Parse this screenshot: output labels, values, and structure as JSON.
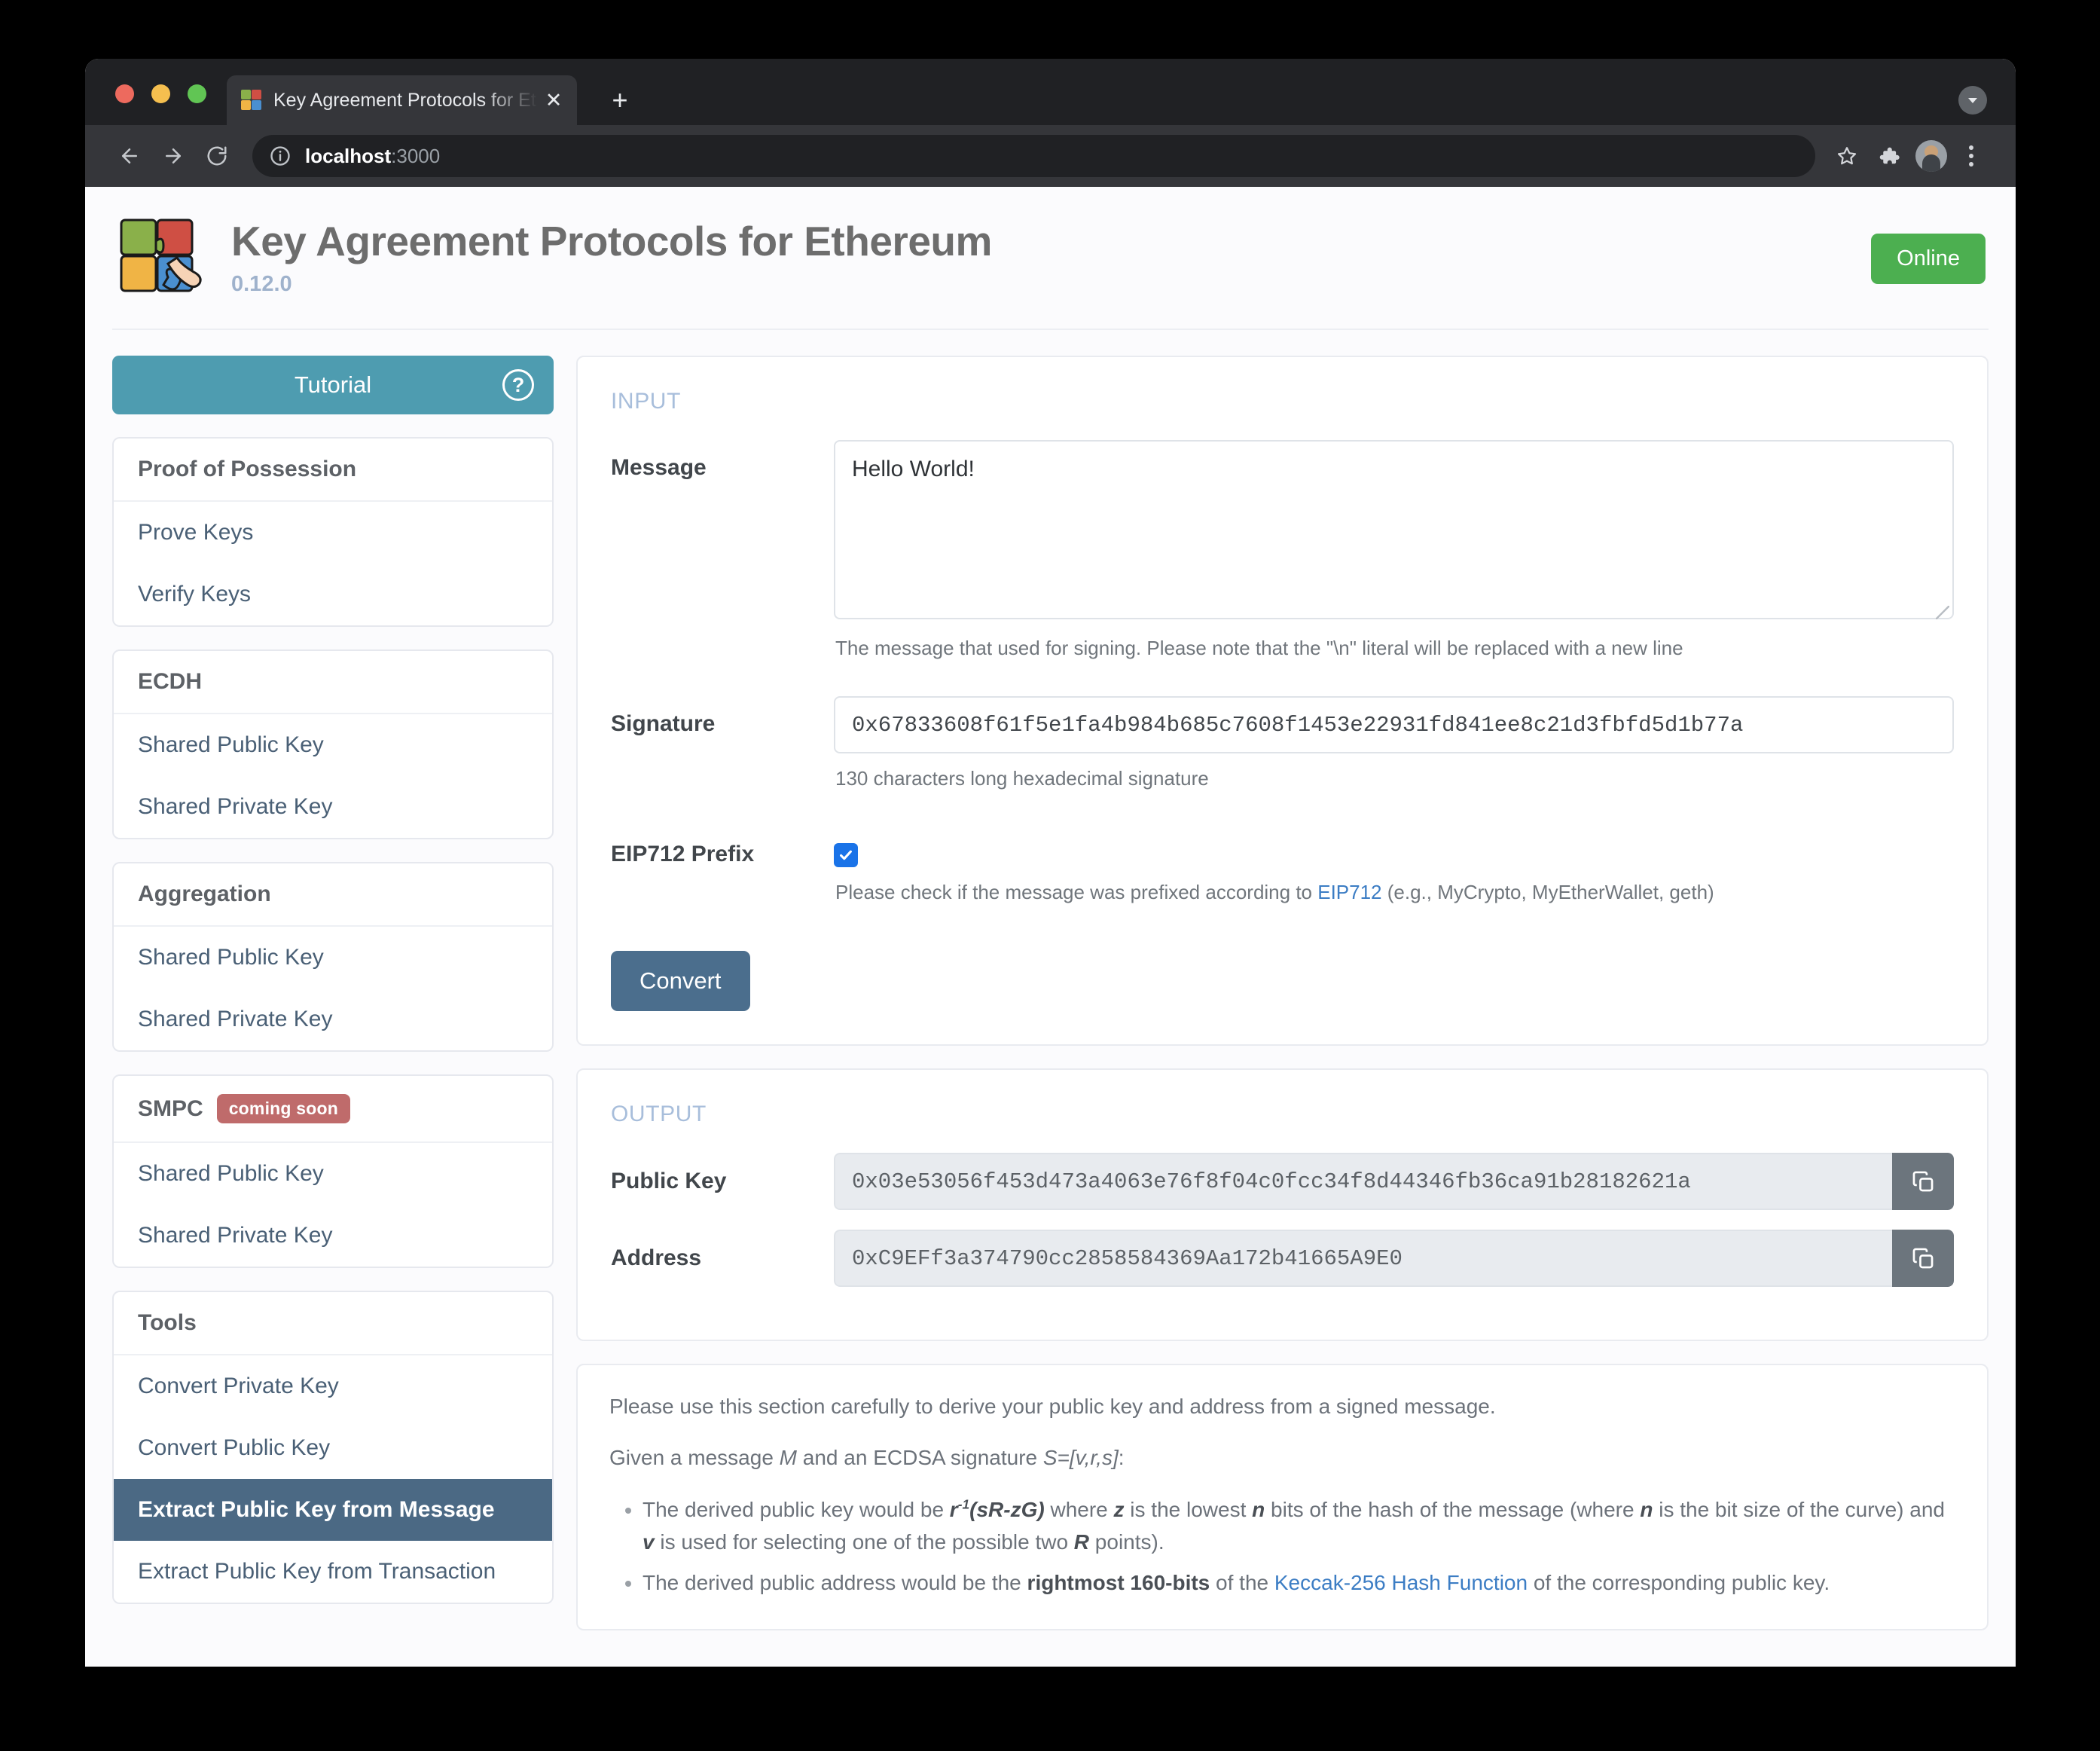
{
  "browser": {
    "tab_title": "Key Agreement Protocols for Et",
    "tab_close_glyph": "✕",
    "new_tab_glyph": "+",
    "url_host": "localhost",
    "url_port": ":3000"
  },
  "header": {
    "title": "Key Agreement Protocols for Ethereum",
    "version": "0.12.0",
    "status": "Online"
  },
  "sidebar": {
    "tutorial_label": "Tutorial",
    "help_glyph": "?",
    "groups": [
      {
        "title": "Proof of Possession",
        "badge": "",
        "items": [
          {
            "label": "Prove Keys",
            "active": false
          },
          {
            "label": "Verify Keys",
            "active": false
          }
        ]
      },
      {
        "title": "ECDH",
        "badge": "",
        "items": [
          {
            "label": "Shared Public Key",
            "active": false
          },
          {
            "label": "Shared Private Key",
            "active": false
          }
        ]
      },
      {
        "title": "Aggregation",
        "badge": "",
        "items": [
          {
            "label": "Shared Public Key",
            "active": false
          },
          {
            "label": "Shared Private Key",
            "active": false
          }
        ]
      },
      {
        "title": "SMPC",
        "badge": "coming soon",
        "items": [
          {
            "label": "Shared Public Key",
            "active": false
          },
          {
            "label": "Shared Private Key",
            "active": false
          }
        ]
      },
      {
        "title": "Tools",
        "badge": "",
        "items": [
          {
            "label": "Convert Private Key",
            "active": false
          },
          {
            "label": "Convert Public Key",
            "active": false
          },
          {
            "label": "Extract Public Key from Message",
            "active": true
          },
          {
            "label": "Extract Public Key from Transaction",
            "active": false
          }
        ]
      }
    ]
  },
  "input_section": {
    "legend": "INPUT",
    "message_label": "Message",
    "message_value": "Hello World!",
    "message_help": "The message that used for signing. Please note that the \"\\n\" literal will be replaced with a new line",
    "signature_label": "Signature",
    "signature_value": "0x67833608f61f5e1fa4b984b685c7608f1453e22931fd841ee8c21d3fbfd5d1b77a",
    "signature_help": "130 characters long hexadecimal signature",
    "eip712_label": "EIP712 Prefix",
    "eip712_checked": true,
    "eip712_help_before": "Please check if the message was prefixed according to ",
    "eip712_help_link": "EIP712",
    "eip712_help_after": " (e.g., MyCrypto, MyEtherWallet, geth)",
    "convert_label": "Convert"
  },
  "output_section": {
    "legend": "OUTPUT",
    "public_key_label": "Public Key",
    "public_key_value": "0x03e53056f453d473a4063e76f8f04c0fcc34f8d44346fb36ca91b28182621a",
    "address_label": "Address",
    "address_value": "0xC9EFf3a374790cc2858584369Aa172b41665A9E0",
    "copy_icon": "copy-icon"
  },
  "info_section": {
    "intro": "Please use this section carefully to derive your public key and address from a signed message.",
    "given_before": "Given a message ",
    "given_m": "M",
    "given_mid": " and an ECDSA signature ",
    "given_s": "S=[v,r,s]",
    "given_after": ":",
    "bullet1": {
      "p1": "The derived public key would be ",
      "formula": "r",
      "formula_sup": "-1",
      "formula2": "(sR-zG)",
      "p2": " where ",
      "z": "z",
      "p3": " is the lowest ",
      "n1": "n",
      "p4": " bits of the hash of the message (where ",
      "n2": "n",
      "p5": " is the bit size of the curve) and ",
      "v": "v",
      "p6": " is used for selecting one of the possible two ",
      "r": "R",
      "p7": " points)."
    },
    "bullet2": {
      "p1": "The derived public address would be the ",
      "strong": "rightmost 160-bits",
      "p2": " of the ",
      "link": "Keccak-256 Hash Function",
      "p3": " of the corresponding public key."
    }
  }
}
